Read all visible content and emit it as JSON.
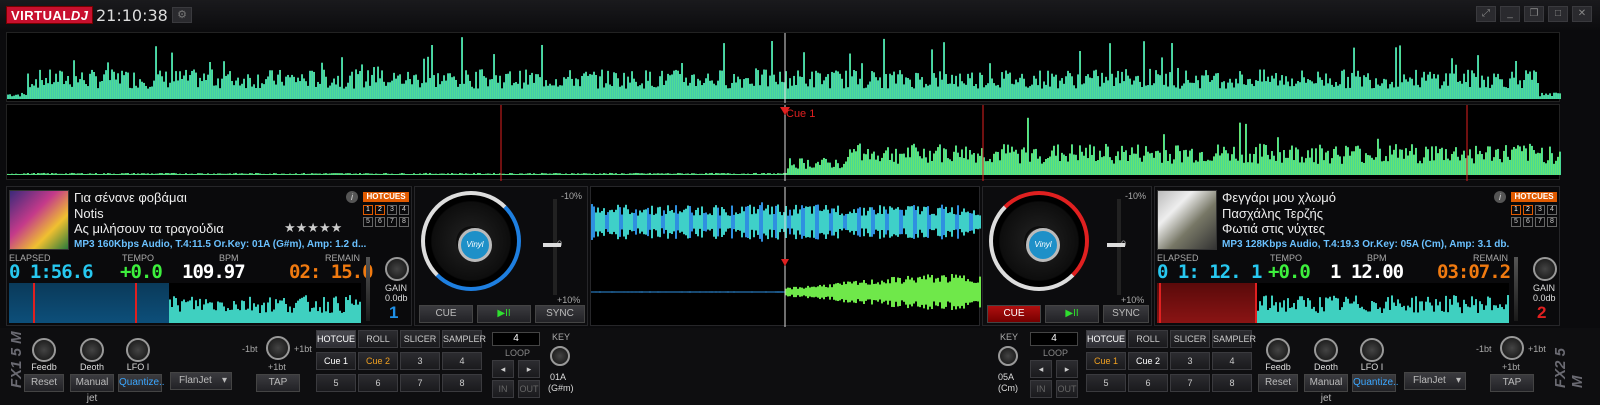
{
  "app": {
    "logo_a": "VIRTUAL",
    "logo_b": "DJ",
    "clock": "21:10:38"
  },
  "waveform": {
    "cue_label": "Cue 1"
  },
  "deck1": {
    "title": "Για σένανε φοβάμαι",
    "artist": "Notis",
    "album": "Ας μιλήσουν τα τραγούδια",
    "rating": "★★★★★",
    "meta": "MP3 160Kbps Audio, T.4:11.5  Or.Key: 01A (G#m), Amp: 1.2 d...",
    "elapsed_label": "ELAPSED",
    "tempo_label": "TEMPO",
    "bpm_label": "BPM",
    "remain_label": "REMAIN",
    "elapsed": "0 1:56.6",
    "tempo": "+0.0",
    "bpm": "109.97",
    "remain": "02: 15.0",
    "gain_label": "GAIN",
    "gain_value": "0.0db",
    "deck_number": "1",
    "hotcues_label": "HOTCUES",
    "pitch_top": "-10%",
    "pitch_mid": "0",
    "pitch_bot": "+10%",
    "cue": "CUE",
    "play": "▶II",
    "sync": "SYNC",
    "jog_label": "Vinyl",
    "colors": {
      "elapsed": "#27c8f0",
      "tempo": "#3df03d",
      "bpm": "#ffffff",
      "remain": "#f07a10",
      "ring": "#1e7fe0"
    }
  },
  "deck2": {
    "title": "Φεγγάρι μου χλωμό",
    "artist": "Πασχάλης Τερζής",
    "album": "Φωτιά στις νύχτες",
    "meta": "MP3 128Kbps Audio, T.4:19.3  Or.Key: 05A (Cm), Amp: 3.1 db.",
    "elapsed_label": "ELAPSED",
    "tempo_label": "TEMPO",
    "bpm_label": "BPM",
    "remain_label": "REMAIN",
    "elapsed": "0 1: 12. 1",
    "tempo": "+0.0",
    "bpm": "1 12.00",
    "remain": "03:07.2",
    "gain_label": "GAIN",
    "gain_value": "0.0db",
    "deck_number": "2",
    "hotcues_label": "HOTCUES",
    "pitch_top": "-10%",
    "pitch_mid": "0",
    "pitch_bot": "+10%",
    "cue": "CUE",
    "play": "▶II",
    "sync": "SYNC",
    "jog_label": "Vinyl",
    "colors": {
      "ring": "#e02020"
    }
  },
  "fx1": {
    "side_label": "FX1 5 M",
    "knobs": [
      {
        "label": "Feedb",
        "btn": "Reset"
      },
      {
        "label": "Deoth",
        "btn": "Manual jet"
      },
      {
        "label": "LFO I",
        "btn": "Quantize.."
      }
    ],
    "effect": "FlanJet",
    "beat_minus": "-1bt",
    "beat_plus": "+1bt",
    "beat_sub": "+1bt",
    "tap": "TAP"
  },
  "fx2": {
    "side_label": "FX2 5 M",
    "knobs": [
      {
        "label": "Feedb",
        "btn": "Reset"
      },
      {
        "label": "Deoth",
        "btn": "Manual jet"
      },
      {
        "label": "LFO I",
        "btn": "Quantize.."
      }
    ],
    "effect": "FlanJet",
    "beat_minus": "-1bt",
    "beat_plus": "+1bt",
    "beat_sub": "+1bt",
    "tap": "TAP"
  },
  "pads1": {
    "tabs": [
      "HOTCUE",
      "ROLL",
      "SLICER",
      "SAMPLER"
    ],
    "row1": [
      "Cue 1",
      "Cue 2",
      "3",
      "4"
    ],
    "row2": [
      "5",
      "6",
      "7",
      "8"
    ],
    "loop_value": "4",
    "loop_label": "LOOP",
    "in": "IN",
    "out": "OUT",
    "key_label": "KEY",
    "key_value": "01A",
    "key_sub": "(G#m)"
  },
  "pads2": {
    "tabs": [
      "HOTCUE",
      "ROLL",
      "SLICER",
      "SAMPLER"
    ],
    "row1": [
      "Cue 1",
      "Cue 2",
      "3",
      "4"
    ],
    "row2": [
      "5",
      "6",
      "7",
      "8"
    ],
    "loop_value": "4",
    "loop_label": "LOOP",
    "in": "IN",
    "out": "OUT",
    "key_label": "KEY",
    "key_value": "05A",
    "key_sub": "(Cm)"
  }
}
